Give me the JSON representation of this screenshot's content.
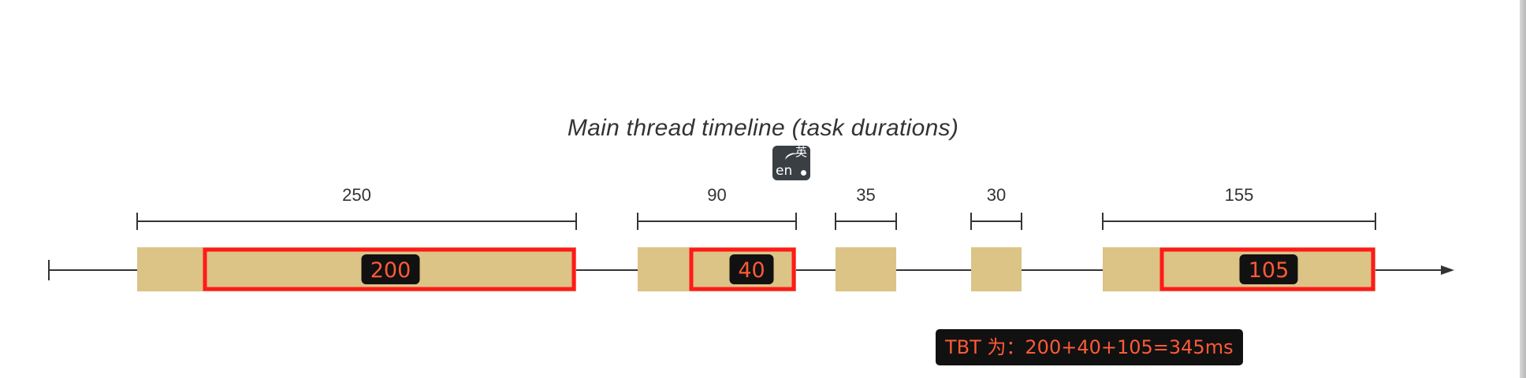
{
  "title": "Main thread timeline (task durations)",
  "ime_badge": {
    "latin": "en",
    "cjk": "英"
  },
  "colors": {
    "task_fill": "#dcc386",
    "blocking_outline": "#ff1a1a",
    "label_bg": "#111111",
    "label_text": "#ff5a36",
    "axis": "#333333"
  },
  "tasks": [
    {
      "duration": "250",
      "blocking": "200"
    },
    {
      "duration": "90",
      "blocking": "40"
    },
    {
      "duration": "35",
      "blocking": null
    },
    {
      "duration": "30",
      "blocking": null
    },
    {
      "duration": "155",
      "blocking": "105"
    }
  ],
  "note": "TBT 为：200+40+105=345ms"
}
